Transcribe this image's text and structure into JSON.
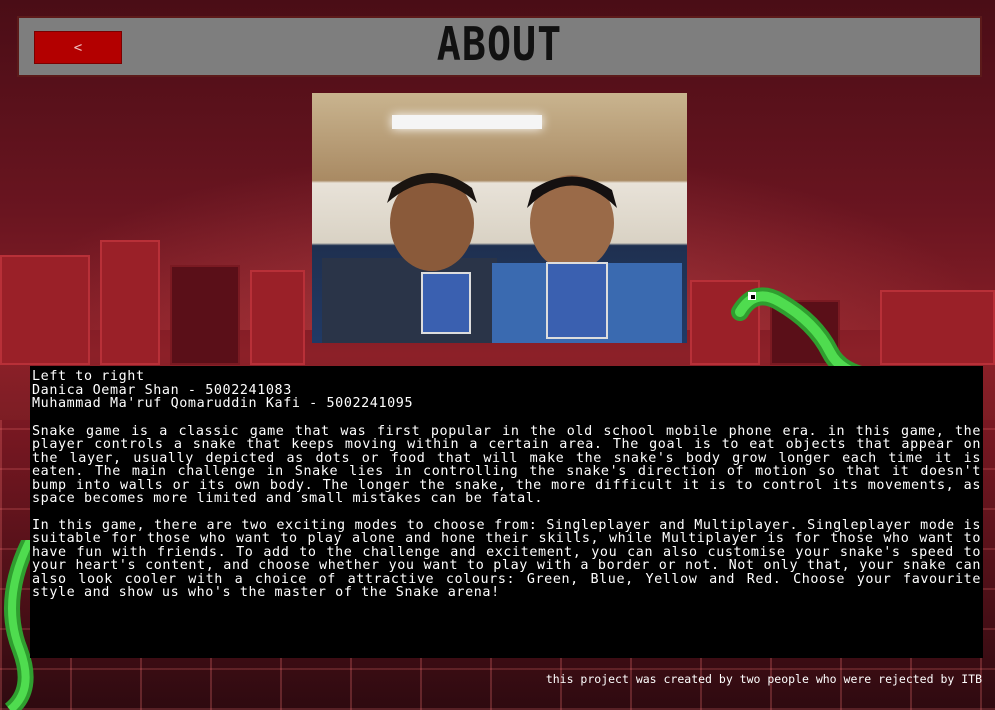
{
  "header": {
    "back_label": "<",
    "title": "ABOUT"
  },
  "photo": {
    "icon": "team-photo"
  },
  "credits": {
    "heading": "Left to right",
    "members": [
      "Danica Oemar Shan - 5002241083",
      "Muhammad Ma'ruf Qomaruddin Kafi - 5002241095"
    ]
  },
  "description": {
    "paragraph1": "Snake game is a classic game that was first popular in the old school mobile phone era. in this game, the player controls a snake that keeps moving within a certain area. The goal is to eat objects that appear on the layer, usually depicted as dots or food that will make the snake's body grow longer each time it is eaten. The main challenge in Snake lies in controlling the snake's direction of motion so that it doesn't bump into walls or its own body. The longer the snake, the more difficult it is to control its movements, as space becomes more limited and small mistakes can be fatal.",
    "paragraph2": "In this game, there are two exciting modes to choose from: Singleplayer and Multiplayer. Singleplayer mode is suitable for those who want to play alone and hone their skills, while Multiplayer is for those who want to have fun with friends. To add to the challenge and excitement, you can also customise your snake's speed to your heart's content, and choose whether you want to play with a border or not. Not only that, your snake can also look cooler with a choice of attractive colours: Green, Blue, Yellow and Red. Choose your favourite style and show us who's the master of the Snake arena!"
  },
  "footer": {
    "text": "this project was created by two people who were rejected by ITB"
  },
  "colors": {
    "header_bg": "#7e7e7e",
    "back_button": "#b30000",
    "text_panel": "#000000",
    "snake": "#3ec23e"
  }
}
